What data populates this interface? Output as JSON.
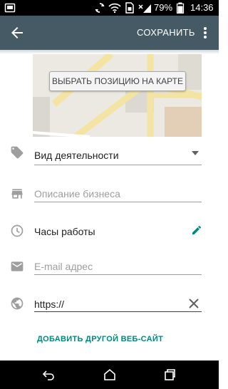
{
  "status_bar": {
    "battery_percent": "79%",
    "time": "14:36"
  },
  "toolbar": {
    "back_icon": "arrow-back-icon",
    "save_label": "СОХРАНИТЬ",
    "more_icon": "more-vert-icon"
  },
  "map": {
    "button_label": "ВЫБРАТЬ ПОЗИЦИЮ НА КАРТЕ"
  },
  "form": {
    "category": {
      "icon": "tag-icon",
      "placeholder": "Вид деятельности",
      "dropdown_icon": "dropdown-arrow-icon"
    },
    "description": {
      "icon": "store-icon",
      "placeholder": "Описание бизнеса"
    },
    "hours": {
      "icon": "clock-icon",
      "label": "Часы работы",
      "edit_icon": "pencil-icon"
    },
    "email": {
      "icon": "email-icon",
      "placeholder": "E-mail адрес"
    },
    "website": {
      "icon": "globe-icon",
      "value": "https://",
      "clear_icon": "close-icon"
    },
    "add_website_label": "ДОБАВИТЬ ДРУГОЙ ВЕБ-САЙТ"
  },
  "colors": {
    "toolbar": "#455a64",
    "accent": "#00897b",
    "edit_icon": "#00897b"
  }
}
